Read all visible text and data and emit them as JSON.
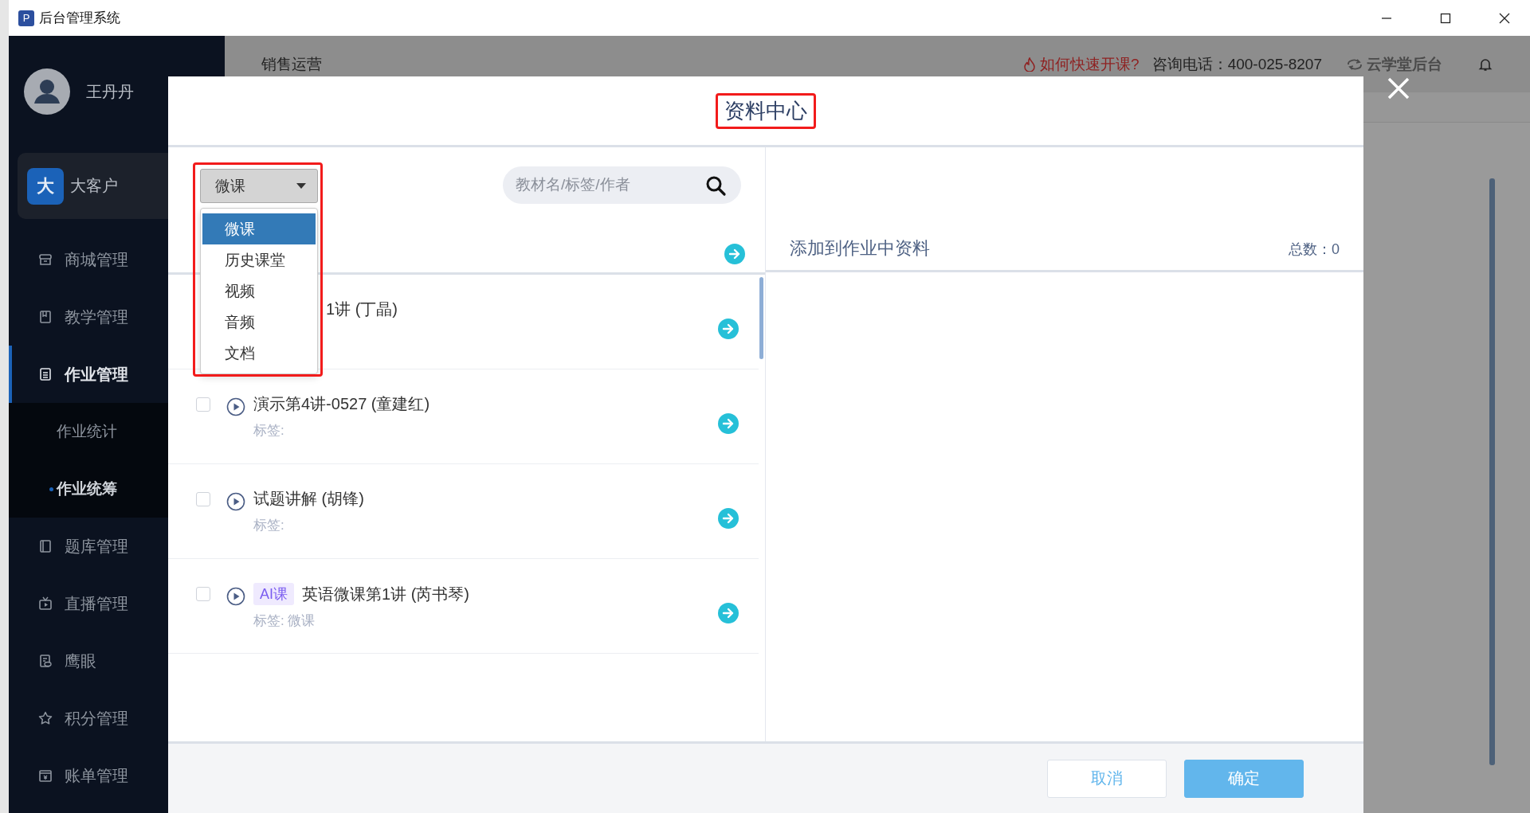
{
  "window": {
    "title": "后台管理系统",
    "app_icon": "P"
  },
  "sidebar": {
    "user": {
      "name": "王丹丹"
    },
    "account": {
      "badge": "大",
      "label": "大客户"
    },
    "items": [
      {
        "label": "商城管理",
        "selected": false
      },
      {
        "label": "教学管理",
        "selected": false
      },
      {
        "label": "作业管理",
        "selected": true,
        "children": [
          {
            "label": "作业统计",
            "selected": false
          },
          {
            "label": "作业统筹",
            "selected": true
          }
        ]
      },
      {
        "label": "题库管理",
        "selected": false
      },
      {
        "label": "直播管理",
        "selected": false
      },
      {
        "label": "鹰眼",
        "selected": false
      },
      {
        "label": "积分管理",
        "selected": false
      },
      {
        "label": "账单管理",
        "selected": false
      }
    ]
  },
  "header": {
    "section": "销售运营",
    "help_link": "如何快速开课?",
    "phone": "咨询电话：400-025-8207",
    "brand": "云学堂后台"
  },
  "modal": {
    "title": "资料中心",
    "title_highlighted": true,
    "type_select": {
      "value": "微课",
      "highlighted": true,
      "options": [
        {
          "label": "微课",
          "selected": true
        },
        {
          "label": "历史课堂",
          "selected": false
        },
        {
          "label": "视频",
          "selected": false
        },
        {
          "label": "音频",
          "selected": false
        },
        {
          "label": "文档",
          "selected": false
        }
      ]
    },
    "search": {
      "placeholder": "教材名/标签/作者"
    },
    "items": [
      {
        "title": "1讲 (丁晶)"
      },
      {
        "title": "演示第4讲-0527 (童建红)",
        "checked": false,
        "tag": "标签:"
      },
      {
        "title": "试题讲解 (胡锋)",
        "checked": false,
        "tag": "标签:"
      },
      {
        "badge": "AI课",
        "title": "英语微课第1讲 (芮书琴)",
        "checked": false,
        "tag": "标签: 微课"
      }
    ],
    "selected_panel": {
      "title": "添加到作业中资料",
      "total": "总数：0"
    },
    "buttons": [
      {
        "label": "取消",
        "kind": "secondary"
      },
      {
        "label": "确定",
        "kind": "primary"
      }
    ]
  }
}
